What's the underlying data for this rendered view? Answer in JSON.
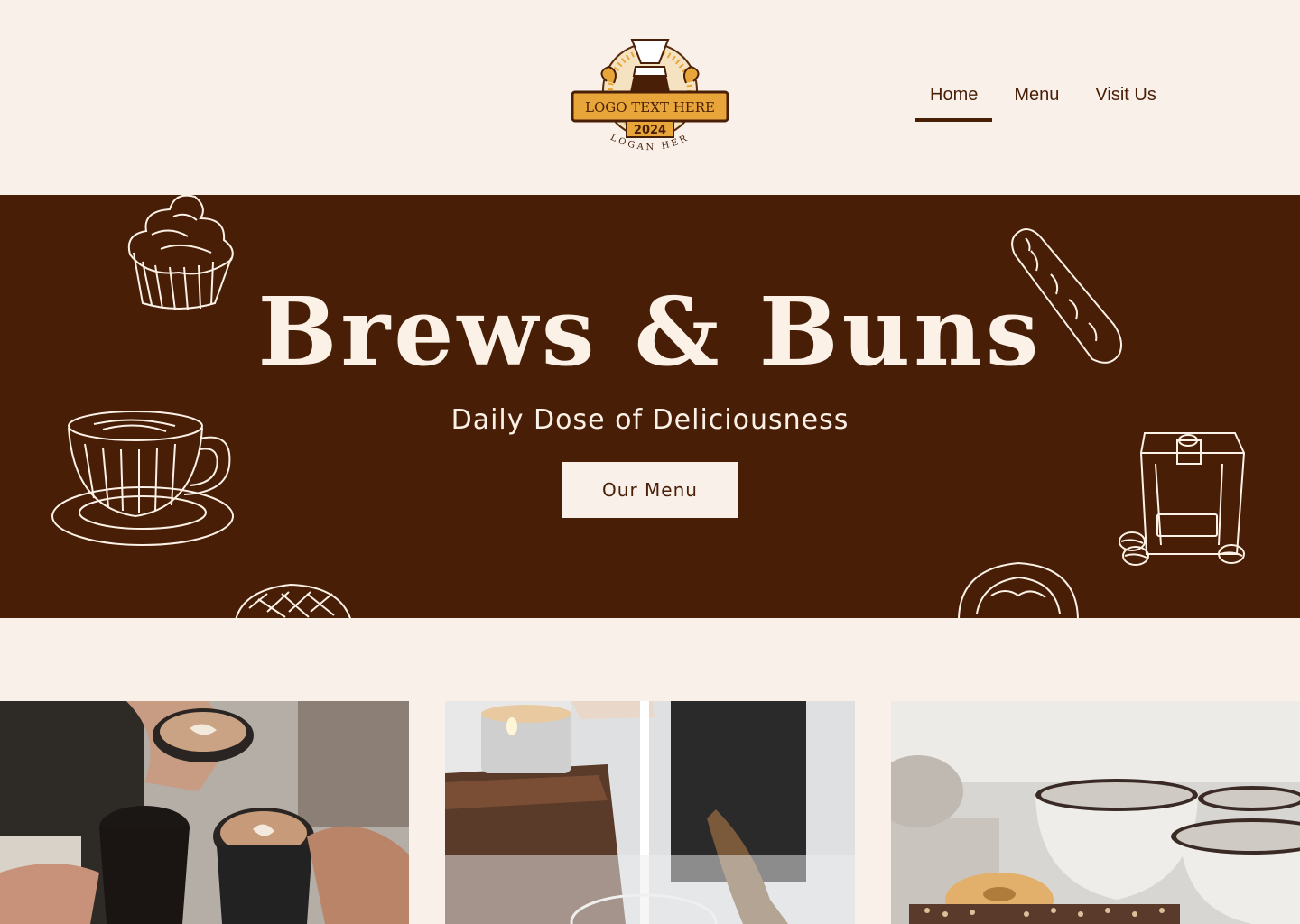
{
  "logo": {
    "main_text": "LOGO TEXT HERE",
    "year": "2024",
    "slogan": "SLOGAN HERE"
  },
  "nav": {
    "items": [
      {
        "label": "Home",
        "active": true
      },
      {
        "label": "Menu",
        "active": false
      },
      {
        "label": "Visit Us",
        "active": false
      }
    ]
  },
  "hero": {
    "title": "Brews & Buns",
    "subtitle": "Daily Dose of Deliciousness",
    "button_label": "Our Menu"
  },
  "colors": {
    "background": "#f8f0e9",
    "brand_brown": "#481e07",
    "cream": "#fbf1e6",
    "logo_gold": "#e8a53a"
  },
  "icons": [
    "cupcake-icon",
    "baguette-icon",
    "coffee-cup-icon",
    "coffee-bag-icon",
    "pastry-icon",
    "donut-icon"
  ]
}
